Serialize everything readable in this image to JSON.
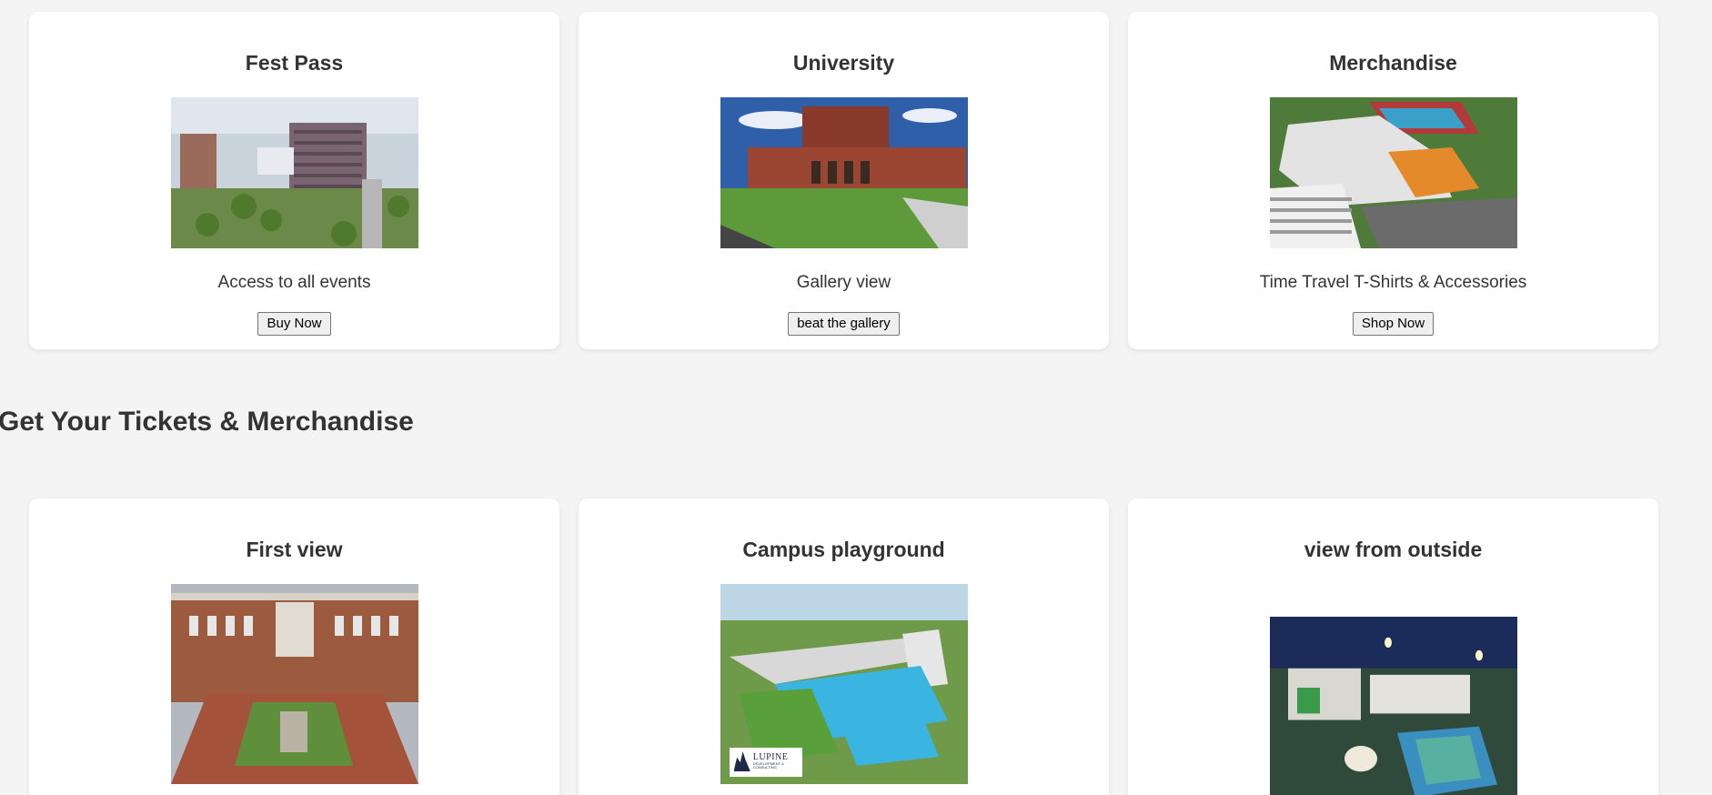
{
  "top_cards": [
    {
      "title": "Fest Pass",
      "image_alt": "campus aerial view with tall building",
      "description": "Access to all events",
      "button_label": "Buy Now"
    },
    {
      "title": "University",
      "image_alt": "red brick university building with lawn",
      "description": "Gallery view",
      "button_label": "beat the gallery"
    },
    {
      "title": "Merchandise",
      "image_alt": "aerial rendering of campus with sports courts",
      "description": "Time Travel T-Shirts & Accessories",
      "button_label": "Shop Now"
    }
  ],
  "section": {
    "heading": "Get Your Tickets & Merchandise"
  },
  "bottom_cards": [
    {
      "title": "First view",
      "image_alt": "brick building courtyard aerial"
    },
    {
      "title": "Campus playground",
      "image_alt": "campus playground rendering with pool",
      "logo_text": "LUPINE",
      "logo_subtext": "DEVELOPMENT & CONSULTING"
    },
    {
      "title": "view from outside",
      "image_alt": "night aerial view of campus"
    }
  ],
  "colors": {
    "page_background": "#f4f4f4",
    "card_background": "#ffffff",
    "text": "#333333"
  }
}
